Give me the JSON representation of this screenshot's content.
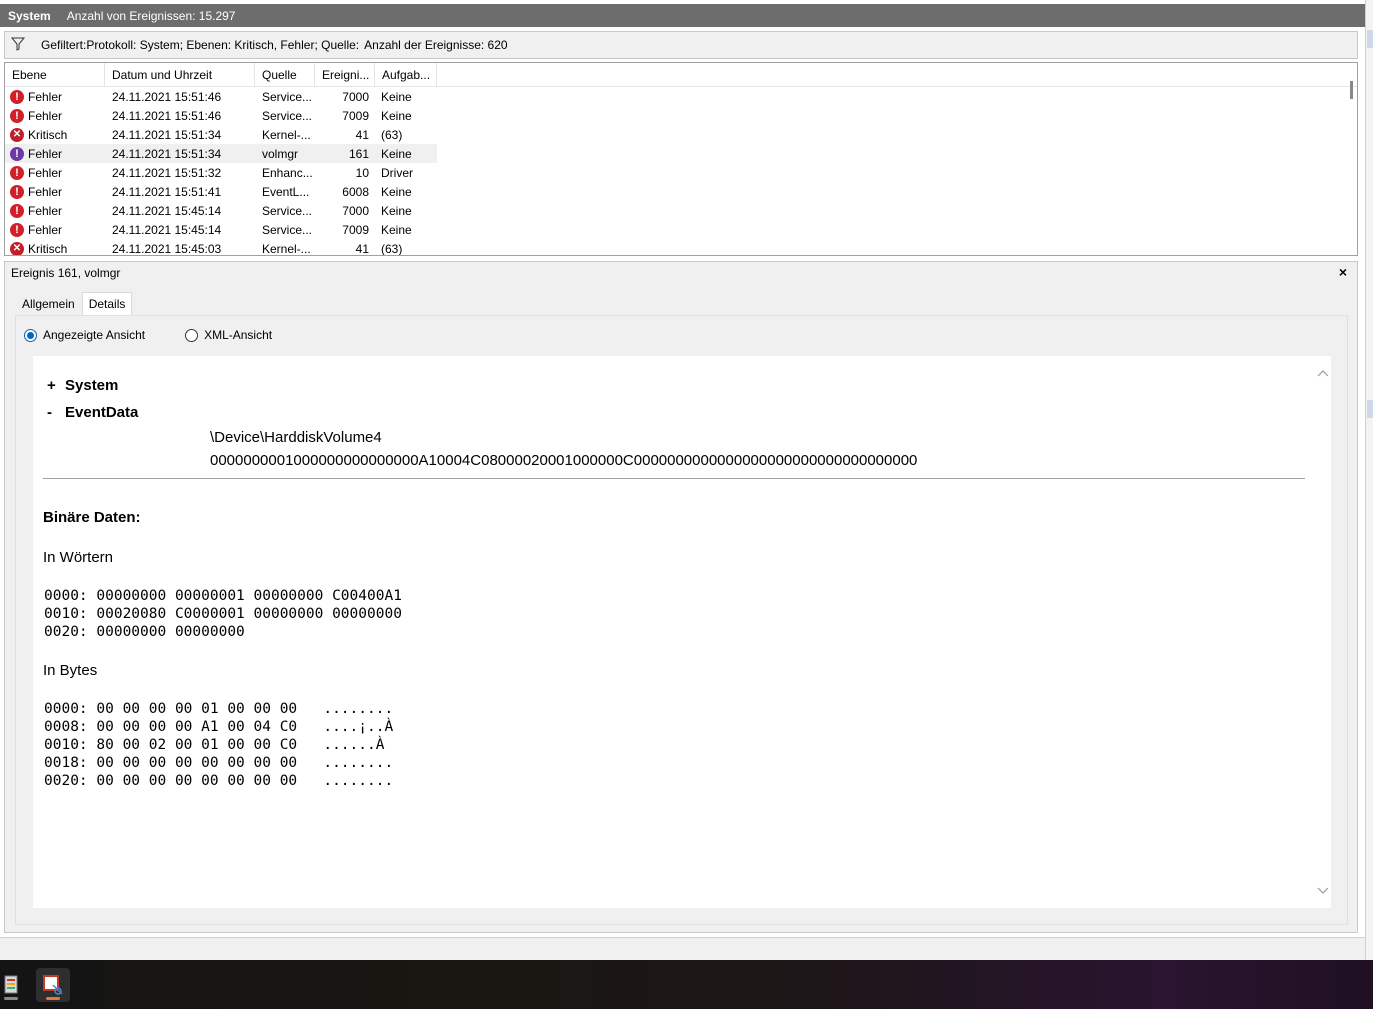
{
  "titlebar": {
    "log_name": "System",
    "event_count": "Anzahl von Ereignissen: 15.297"
  },
  "filterbar": {
    "icon": "filter-icon",
    "text": "Gefiltert:Protokoll: System; Ebenen: Kritisch, Fehler; Quelle:",
    "count": "Anzahl der Ereignisse: 620"
  },
  "eventlist": {
    "columns": [
      "Ebene",
      "Datum und Uhrzeit",
      "Quelle",
      "Ereigni...",
      "Aufgab..."
    ],
    "rows": [
      {
        "level": "Fehler",
        "icon": "error-icon",
        "datetime": "24.11.2021 15:51:46",
        "source": "Service...",
        "id": "7000",
        "task": "Keine"
      },
      {
        "level": "Fehler",
        "icon": "error-icon",
        "datetime": "24.11.2021 15:51:46",
        "source": "Service...",
        "id": "7009",
        "task": "Keine"
      },
      {
        "level": "Kritisch",
        "icon": "critical-icon",
        "datetime": "24.11.2021 15:51:34",
        "source": "Kernel-...",
        "id": "41",
        "task": "(63)"
      },
      {
        "level": "Fehler",
        "icon": "error-icon",
        "datetime": "24.11.2021 15:51:34",
        "source": "volmgr",
        "id": "161",
        "task": "Keine",
        "selected": true
      },
      {
        "level": "Fehler",
        "icon": "error-icon",
        "datetime": "24.11.2021 15:51:32",
        "source": "Enhanc...",
        "id": "10",
        "task": "Driver"
      },
      {
        "level": "Fehler",
        "icon": "error-icon",
        "datetime": "24.11.2021 15:51:41",
        "source": "EventL...",
        "id": "6008",
        "task": "Keine"
      },
      {
        "level": "Fehler",
        "icon": "error-icon",
        "datetime": "24.11.2021 15:45:14",
        "source": "Service...",
        "id": "7000",
        "task": "Keine"
      },
      {
        "level": "Fehler",
        "icon": "error-icon",
        "datetime": "24.11.2021 15:45:14",
        "source": "Service...",
        "id": "7009",
        "task": "Keine"
      },
      {
        "level": "Kritisch",
        "icon": "critical-icon",
        "datetime": "24.11.2021 15:45:03",
        "source": "Kernel-...",
        "id": "41",
        "task": "(63)"
      }
    ]
  },
  "details": {
    "title": "Ereignis 161, volmgr",
    "close": "×",
    "tabs": [
      "Allgemein",
      "Details"
    ],
    "active_tab": "Details",
    "radio_displayed": "Angezeigte Ansicht",
    "radio_xml": "XML-Ansicht",
    "tree_system_symbol": "+",
    "tree_system": "System",
    "tree_eventdata_symbol": "-",
    "tree_eventdata": "EventData",
    "eventdata_values": [
      "\\Device\\HarddiskVolume4",
      "0000000001000000000000000A10004C08000020001000000C0000000000000000000000000000000000"
    ],
    "binary_header": "Binäre Daten:",
    "in_words": "In Wörtern",
    "words_lines": [
      "0000: 00000000 00000001 00000000 C00400A1",
      "0010: 00020080 C0000001 00000000 00000000",
      "0020: 00000000 00000000"
    ],
    "in_bytes": "In Bytes",
    "bytes_lines": [
      "0000: 00 00 00 00 01 00 00 00   ........",
      "0008: 00 00 00 00 A1 00 04 C0   ....¡..À",
      "0010: 80 00 02 00 01 00 00 C0   ......À",
      "0018: 00 00 00 00 00 00 00 00   ........",
      "0020: 00 00 00 00 00 00 00 00   ........"
    ]
  },
  "taskbar": {
    "items": [
      {
        "icon": "event-viewer-icon"
      },
      {
        "icon": "snipping-tool-icon"
      }
    ]
  }
}
